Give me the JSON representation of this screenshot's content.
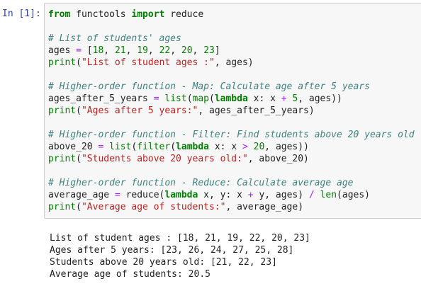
{
  "cell": {
    "prompt": "In [1]:",
    "lines": [
      [
        [
          "kw",
          "from"
        ],
        [
          "pl",
          " functools "
        ],
        [
          "kw",
          "import"
        ],
        [
          "pl",
          " reduce"
        ]
      ],
      [],
      [
        [
          "cm",
          "# List of students' ages"
        ]
      ],
      [
        [
          "pl",
          "ages "
        ],
        [
          "op",
          "="
        ],
        [
          "pl",
          " ["
        ],
        [
          "num",
          "18"
        ],
        [
          "pl",
          ", "
        ],
        [
          "num",
          "21"
        ],
        [
          "pl",
          ", "
        ],
        [
          "num",
          "19"
        ],
        [
          "pl",
          ", "
        ],
        [
          "num",
          "22"
        ],
        [
          "pl",
          ", "
        ],
        [
          "num",
          "20"
        ],
        [
          "pl",
          ", "
        ],
        [
          "num",
          "23"
        ],
        [
          "pl",
          "]"
        ]
      ],
      [
        [
          "bi",
          "print"
        ],
        [
          "pl",
          "("
        ],
        [
          "str",
          "\"List of student ages :\""
        ],
        [
          "pl",
          ", ages)"
        ]
      ],
      [],
      [
        [
          "cm",
          "# Higher-order function - Map: Calculate age after 5 years"
        ]
      ],
      [
        [
          "pl",
          "ages_after_5_years "
        ],
        [
          "op",
          "="
        ],
        [
          "pl",
          " "
        ],
        [
          "bi",
          "list"
        ],
        [
          "pl",
          "("
        ],
        [
          "bi",
          "map"
        ],
        [
          "pl",
          "("
        ],
        [
          "kw",
          "lambda"
        ],
        [
          "pl",
          " x: x "
        ],
        [
          "op",
          "+"
        ],
        [
          "pl",
          " "
        ],
        [
          "num",
          "5"
        ],
        [
          "pl",
          ", ages))"
        ]
      ],
      [
        [
          "bi",
          "print"
        ],
        [
          "pl",
          "("
        ],
        [
          "str",
          "\"Ages after 5 years:\""
        ],
        [
          "pl",
          ", ages_after_5_years)"
        ]
      ],
      [],
      [
        [
          "cm",
          "# Higher-order function - Filter: Find students above 20 years old"
        ]
      ],
      [
        [
          "pl",
          "above_20 "
        ],
        [
          "op",
          "="
        ],
        [
          "pl",
          " "
        ],
        [
          "bi",
          "list"
        ],
        [
          "pl",
          "("
        ],
        [
          "bi",
          "filter"
        ],
        [
          "pl",
          "("
        ],
        [
          "kw",
          "lambda"
        ],
        [
          "pl",
          " x: x "
        ],
        [
          "op",
          ">"
        ],
        [
          "pl",
          " "
        ],
        [
          "num",
          "20"
        ],
        [
          "pl",
          ", ages))"
        ]
      ],
      [
        [
          "bi",
          "print"
        ],
        [
          "pl",
          "("
        ],
        [
          "str",
          "\"Students above 20 years old:\""
        ],
        [
          "pl",
          ", above_20)"
        ]
      ],
      [],
      [
        [
          "cm",
          "# Higher-order function - Reduce: Calculate average age"
        ]
      ],
      [
        [
          "pl",
          "average_age "
        ],
        [
          "op",
          "="
        ],
        [
          "pl",
          " reduce("
        ],
        [
          "kw",
          "lambda"
        ],
        [
          "pl",
          " x, y: x "
        ],
        [
          "op",
          "+"
        ],
        [
          "pl",
          " y, ages) "
        ],
        [
          "op",
          "/"
        ],
        [
          "pl",
          " "
        ],
        [
          "bi",
          "len"
        ],
        [
          "pl",
          "(ages)"
        ]
      ],
      [
        [
          "bi",
          "print"
        ],
        [
          "pl",
          "("
        ],
        [
          "str",
          "\"Average age of students:\""
        ],
        [
          "pl",
          ", average_age)"
        ]
      ]
    ]
  },
  "output": {
    "lines": [
      "List of student ages : [18, 21, 19, 22, 20, 23]",
      "Ages after 5 years: [23, 26, 24, 27, 25, 28]",
      "Students above 20 years old: [21, 22, 23]",
      "Average age of students: 20.5"
    ]
  }
}
